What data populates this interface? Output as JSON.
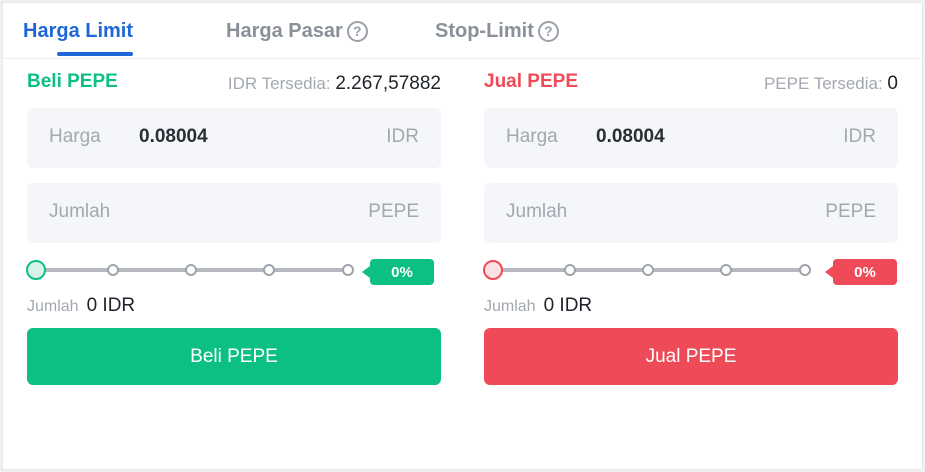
{
  "tabs": [
    {
      "label": "Harga Limit",
      "active": true,
      "help_icon": false
    },
    {
      "label": "Harga Pasar",
      "active": false,
      "help_icon": true
    },
    {
      "label": "Stop-Limit",
      "active": false,
      "help_icon": true
    }
  ],
  "help_icon_glyph": "?",
  "colors": {
    "accent": "#1f66d6",
    "buy": "#0cbf82",
    "sell": "#ef4a57"
  },
  "buy": {
    "title": "Beli PEPE",
    "available_label": "IDR Tersedia: ",
    "available_value": "2.267,57882",
    "price": {
      "label": "Harga",
      "value": "0.08004",
      "unit": "IDR"
    },
    "amount": {
      "label": "Jumlah",
      "value": "",
      "unit": "PEPE"
    },
    "slider_percent_label": "0%",
    "slider_value": 0,
    "total_label": "Jumlah",
    "total_value": "0 IDR",
    "button_label": "Beli PEPE"
  },
  "sell": {
    "title": "Jual PEPE",
    "available_label": "PEPE Tersedia: ",
    "available_value": "0",
    "price": {
      "label": "Harga",
      "value": "0.08004",
      "unit": "IDR"
    },
    "amount": {
      "label": "Jumlah",
      "value": "",
      "unit": "PEPE"
    },
    "slider_percent_label": "0%",
    "slider_value": 0,
    "total_label": "Jumlah",
    "total_value": "0 IDR",
    "button_label": "Jual PEPE"
  }
}
